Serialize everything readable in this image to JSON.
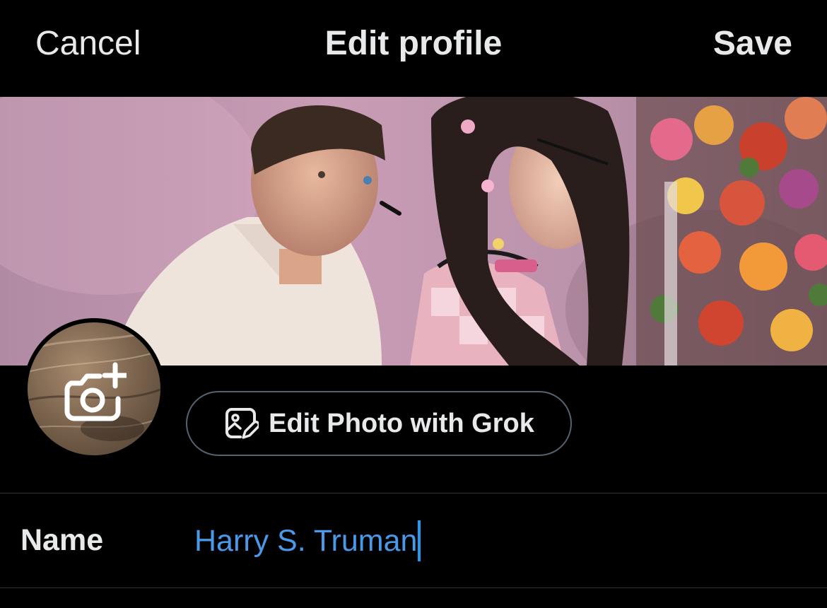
{
  "header": {
    "cancel_label": "Cancel",
    "title": "Edit profile",
    "save_label": "Save"
  },
  "banner": {
    "description_icon": "banner-photo"
  },
  "avatar": {
    "overlay_icon": "camera-plus-icon"
  },
  "grok_button": {
    "icon": "image-edit-icon",
    "label": "Edit Photo with Grok"
  },
  "fields": {
    "name": {
      "label": "Name",
      "value": "Harry S. Truman"
    }
  },
  "colors": {
    "background": "#000000",
    "text": "#e7e9ea",
    "input_text": "#4a99e9",
    "caret": "#1d9bf0",
    "border": "#536471",
    "divider": "#2f3336"
  }
}
